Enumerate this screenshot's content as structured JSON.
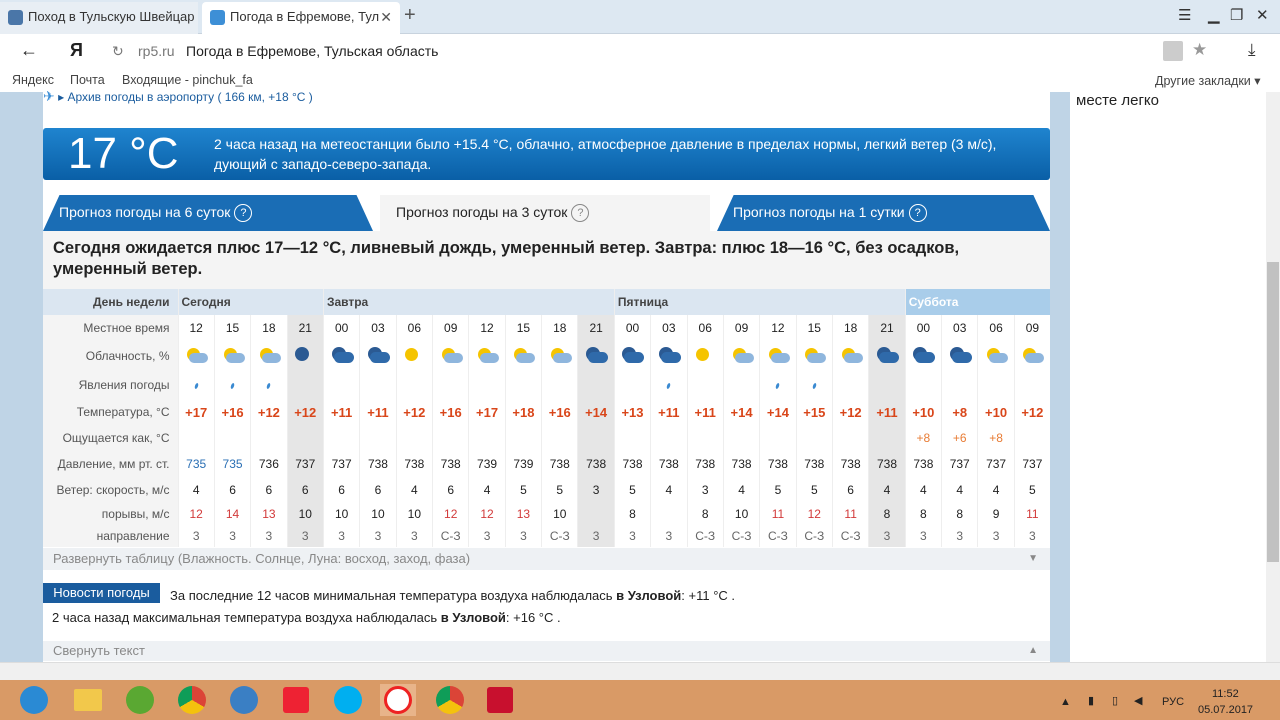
{
  "browser": {
    "tabs": [
      {
        "label": "Поход в Тульскую Швейцар"
      },
      {
        "label": "Погода в Ефремове, Тул"
      }
    ],
    "new_tab": "+",
    "back": "←",
    "logo": "Я",
    "url_domain": "rp5.ru",
    "url_title": "Погода в Ефремове, Тульская область",
    "bookmarks": [
      "Яндекс",
      "Почта",
      "Входящие - pinchuk_fa"
    ],
    "other_bookmarks": "Другие закладки"
  },
  "page": {
    "archive_link": "Архив погоды в аэропорту ( 166 км, +18 °C )",
    "right_col_text": "месте легко",
    "current": {
      "temp": "17 °C",
      "text": "2 часа назад на метеостанции было +15.4 °C, облачно, атмосферное давление в пределах нормы, легкий ветер (3 м/с), дующий с западо-северо-запада."
    },
    "forecast_tabs": [
      "Прогноз погоды на 6 суток",
      "Прогноз погоды на 3 суток",
      "Прогноз погоды на 1 сутки"
    ],
    "summary": "Сегодня ожидается плюс 17—12 °С, ливневый дождь, умеренный ветер. Завтра: плюс 18—16 °С, без осадков, умеренный ветер.",
    "table": {
      "labels": {
        "day": "День недели",
        "time": "Местное время",
        "clouds": "Облачность, %",
        "phenomena": "Явления погоды",
        "temp": "Температура, °С",
        "feels": "Ощущается как, °С",
        "pressure": "Давление, мм рт. ст.",
        "wind": "Ветер: скорость, м/с",
        "gusts": "порывы, м/с",
        "dir": "направление"
      },
      "days": [
        "Сегодня",
        "Завтра",
        "Пятница",
        "Суббота"
      ],
      "times": [
        "12",
        "15",
        "18",
        "21",
        "00",
        "03",
        "06",
        "09",
        "12",
        "15",
        "18",
        "21",
        "00",
        "03",
        "06",
        "09",
        "12",
        "15",
        "18",
        "21",
        "00",
        "03",
        "06",
        "09"
      ],
      "temps": [
        "+17",
        "+16",
        "+12",
        "+12",
        "+11",
        "+11",
        "+12",
        "+16",
        "+17",
        "+18",
        "+16",
        "+14",
        "+13",
        "+11",
        "+11",
        "+14",
        "+14",
        "+15",
        "+12",
        "+11",
        "+10",
        "+8",
        "+10",
        "+12"
      ],
      "feels": [
        "",
        "",
        "",
        "",
        "",
        "",
        "",
        "",
        "",
        "",
        "",
        "",
        "",
        "",
        "",
        "",
        "",
        "",
        "",
        "",
        "+8",
        "+6",
        "+8",
        ""
      ],
      "pressure": [
        "735",
        "735",
        "736",
        "737",
        "737",
        "738",
        "738",
        "738",
        "739",
        "739",
        "738",
        "738",
        "738",
        "738",
        "738",
        "738",
        "738",
        "738",
        "738",
        "738",
        "738",
        "737",
        "737",
        "737"
      ],
      "wind": [
        "4",
        "6",
        "6",
        "6",
        "6",
        "6",
        "4",
        "6",
        "4",
        "5",
        "5",
        "3",
        "5",
        "4",
        "3",
        "4",
        "5",
        "5",
        "6",
        "4",
        "4",
        "4",
        "4",
        "5"
      ],
      "gusts": [
        "12",
        "14",
        "13",
        "10",
        "10",
        "10",
        "10",
        "12",
        "12",
        "13",
        "10",
        "",
        "8",
        "",
        "8",
        "10",
        "11",
        "12",
        "11",
        "8",
        "8",
        "8",
        "9",
        "11"
      ],
      "dir": [
        "3",
        "3",
        "3",
        "3",
        "3",
        "3",
        "3",
        "С-З",
        "3",
        "3",
        "С-З",
        "3",
        "3",
        "3",
        "С-З",
        "С-З",
        "С-З",
        "С-З",
        "С-З",
        "3",
        "3",
        "3",
        "3",
        "3"
      ]
    },
    "expand": "Развернуть таблицу (Влажность. Солнце, Луна: восход, заход, фаза)",
    "news_badge": "Новости погоды",
    "news1_pre": "За последние 12 часов минимальная температура воздуха наблюдалась ",
    "news1_place": "в Узловой",
    "news1_post": ": +11 °C .",
    "news2_pre": "2 часа назад максимальная температура воздуха наблюдалась ",
    "news2_place": "в Узловой",
    "news2_post": ": +16 °C .",
    "collapse": "Свернуть текст"
  },
  "tray": {
    "lang": "РУС",
    "time": "11:52",
    "date": "05.07.2017"
  }
}
